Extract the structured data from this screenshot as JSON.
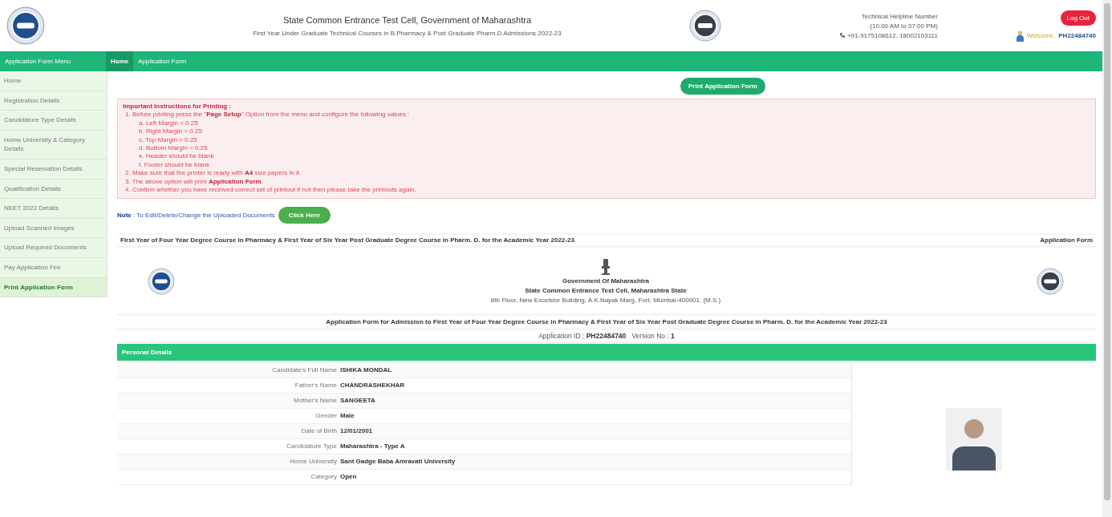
{
  "header": {
    "title": "State Common Entrance Test Cell, Government of Maharashtra",
    "subtitle": "First Year Under Graduate Technical Courses in B.Pharmacy & Post Graduate Pharm.D Admissions 2022-23",
    "helpline_title": "Technical Helpline Number",
    "helpline_hours": "(10:00 AM to 07:00 PM)",
    "helpline_phone": "+91-9175108612, 18002103111",
    "logout": "Log Out",
    "welcome": "Welcome,",
    "user_id": "PH22484740"
  },
  "nav": {
    "menu_title": "Application Form Menu",
    "tabs": [
      {
        "label": "Home",
        "selected": true
      },
      {
        "label": "Application Form",
        "selected": false
      }
    ]
  },
  "sidebar": {
    "items": [
      {
        "label": "Home",
        "selected": false
      },
      {
        "label": "Registration Details",
        "selected": false
      },
      {
        "label": "Candidature Type Details",
        "selected": false
      },
      {
        "label": "Home University & Category Details",
        "selected": false
      },
      {
        "label": "Special Reservation Details",
        "selected": false
      },
      {
        "label": "Qualification Details",
        "selected": false
      },
      {
        "label": "NEET 2022 Details",
        "selected": false
      },
      {
        "label": "Upload Scanned Images",
        "selected": false
      },
      {
        "label": "Upload Required Documents",
        "selected": false
      },
      {
        "label": "Pay Application Fee",
        "selected": false
      },
      {
        "label": "Print Application Form",
        "selected": true
      }
    ]
  },
  "print_button": "Print Application Form",
  "instructions": {
    "title": "Important Instructions for Printing :",
    "items": [
      {
        "text": "1. Before printing press the \"**Page Setup**\" Option from the menu and configure the following values :",
        "sub": [
          "a. Left Margin = 0.25",
          "b. Right Margin = 0.25",
          "c. Top Margin = 0.25",
          "d. Bottom Margin = 0.25",
          "e. Header should be blank",
          "f. Footer should be blank"
        ]
      },
      {
        "text": "2. Make sure that the printer is ready with **A4** size papers in it."
      },
      {
        "text": "3. The above option will print **Application Form**."
      },
      {
        "text": "4. Confirm whether you have received correct set of printout if not then please take the printouts again."
      }
    ]
  },
  "note": {
    "text": "**Note** : To Edit/Delete/Change the Uploaded Documents",
    "button": "Click Here"
  },
  "form": {
    "course_line": "First Year of Four Year Degree Course in Pharmacy & First Year of Six Year Post Graduate Degree Course in Pharm. D. for the Academic Year 2022-23",
    "form_label": "Application Form",
    "government": "Government Of Maharashtra",
    "cell": "State Common Entrance Test Cell, Maharashtra State",
    "address": "8th Floor, New Excelsior Building, A.K.Nayak Marg, Fort, Mumbai-400001. (M.S.)",
    "heading": "Application Form for Admission to First Year of Four Year Degree Course in Pharmacy & First Year of Six Year Post Graduate Degree Course in Pharm. D. for the Academic Year 2022-23",
    "application_id_label": "Application ID :",
    "application_id": "PH22484740",
    "version_label": "Version No :",
    "version": "1",
    "section": "Personal Details",
    "rows": [
      {
        "label": "Candidate's Full Name",
        "value": "ISHIKA MONDAL"
      },
      {
        "label": "Father's Name",
        "value": "CHANDRASHEKHAR"
      },
      {
        "label": "Mother's Name",
        "value": "SANGEETA"
      },
      {
        "label": "Gender",
        "value": "Male"
      },
      {
        "label": "Date of Birth",
        "value": "12/01/2001"
      },
      {
        "label": "Candidature Type",
        "value": "Maharashtra - Type A"
      },
      {
        "label": "Home University",
        "value": "Sant Gadge Baba Amravati University"
      },
      {
        "label": "Category",
        "value": "Open"
      }
    ]
  }
}
